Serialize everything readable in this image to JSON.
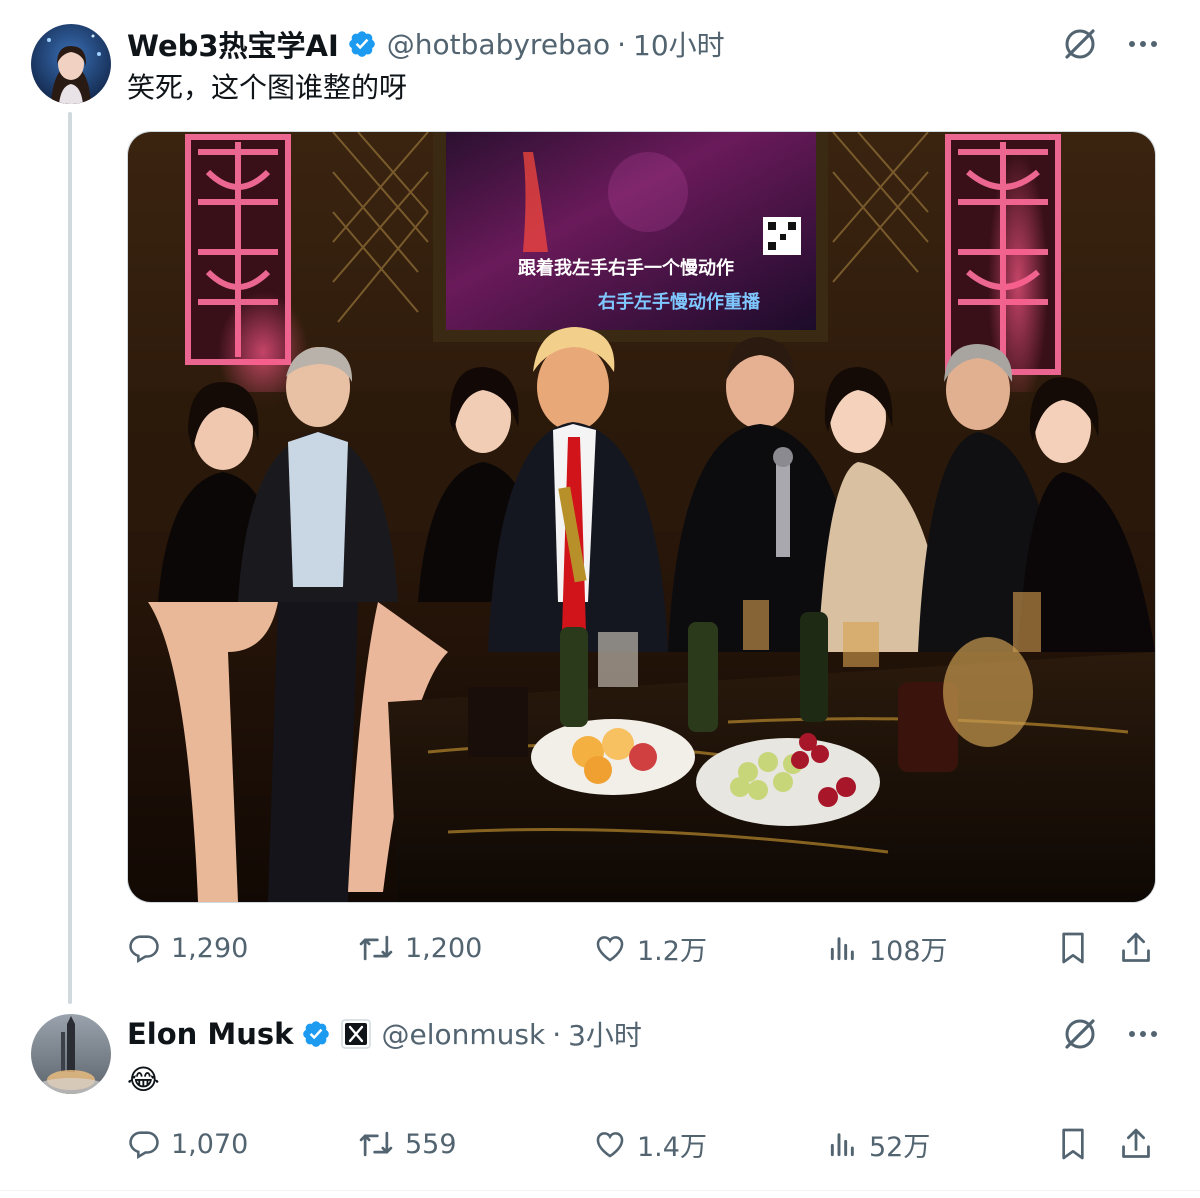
{
  "post": {
    "author_name": "Web3热宝学AI",
    "handle": "@hotbabyrebao",
    "separator": "·",
    "time": "10小时",
    "text": "笑死，这个图谁整的呀",
    "media": {
      "tv_lyric_1": "跟着我左手右手一个慢动作",
      "tv_lyric_2": "右手左手慢动作重播"
    },
    "stats": {
      "replies": "1,290",
      "reposts": "1,200",
      "likes": "1.2万",
      "views": "108万"
    }
  },
  "reply": {
    "author_name": "Elon Musk",
    "handle": "@elonmusk",
    "separator": "·",
    "time": "3小时",
    "text": "😂",
    "stats": {
      "replies": "1,070",
      "reposts": "559",
      "likes": "1.4万",
      "views": "52万"
    }
  },
  "colors": {
    "verified": "#1d9bf0",
    "muted": "#536471",
    "thread_line": "#cfd9de"
  },
  "icons": [
    "verified-badge-icon",
    "x-affiliate-badge-icon",
    "grok-icon",
    "more-icon",
    "reply-icon",
    "repost-icon",
    "like-icon",
    "views-icon",
    "bookmark-icon",
    "share-icon"
  ]
}
